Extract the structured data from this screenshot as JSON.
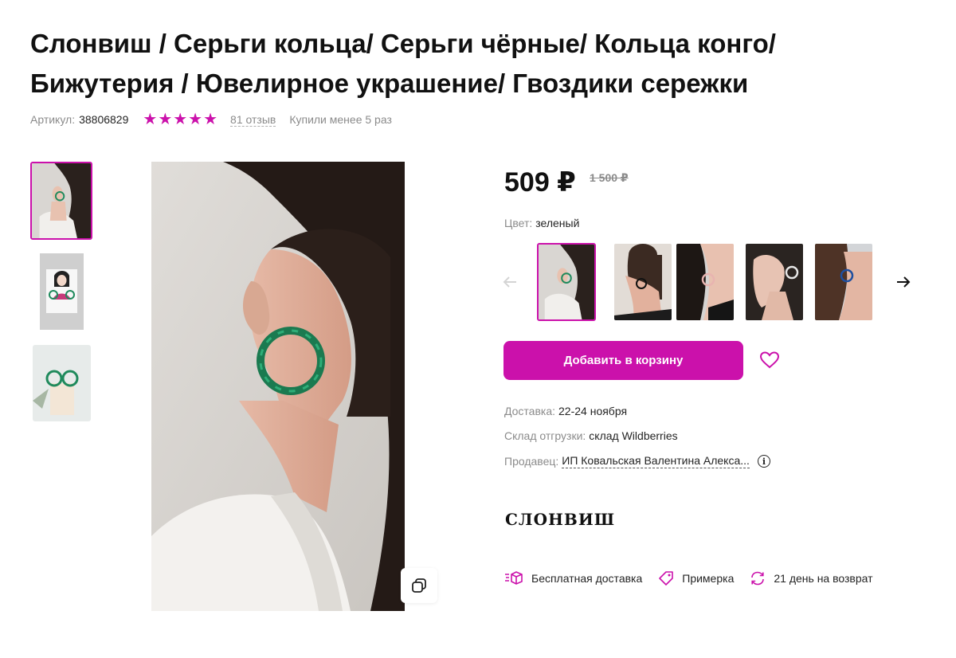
{
  "product": {
    "title": "Слонвиш / Серьги кольца/ Серьги чёрные/ Кольца конго/ Бижутерия / Ювелирное украшение/ Гвоздики сережки",
    "article_label": "Артикул:",
    "article_value": "38806829",
    "rating": 5,
    "stars_text": "★★★★★",
    "reviews": "81 отзыв",
    "bought": "Купили менее 5 раз"
  },
  "price": {
    "current": "509 ₽",
    "old": "1 500 ₽"
  },
  "color": {
    "label": "Цвет:",
    "value": "зеленый"
  },
  "gallery": {
    "thumbnails": [
      "photo-green-earring-model",
      "photo-card-illustration",
      "photo-green-earrings-display"
    ],
    "active_index": 0
  },
  "variants": [
    {
      "ring_color": "#1f8a5c",
      "active": true
    },
    {
      "ring_color": "#111111",
      "active": false
    },
    {
      "ring_color": "#e8b4b0",
      "active": false
    },
    {
      "ring_color": "#e6e6e6",
      "active": false
    },
    {
      "ring_color": "#1e4fa0",
      "active": false
    }
  ],
  "actions": {
    "add_to_cart": "Добавить в корзину"
  },
  "delivery": {
    "label": "Доставка:",
    "value": "22-24 ноября"
  },
  "warehouse": {
    "label": "Склад отгрузки:",
    "value": "склад Wildberries"
  },
  "seller": {
    "label": "Продавец:",
    "value": "ИП Ковальская Валентина Алекса...",
    "info_icon": "i"
  },
  "brand": {
    "logo_text": "СЛОНВИШ"
  },
  "features": [
    {
      "label": "Бесплатная доставка",
      "icon": "truck-box-icon"
    },
    {
      "label": "Примерка",
      "icon": "tag-icon"
    },
    {
      "label": "21 день на возврат",
      "icon": "refresh-icon"
    }
  ],
  "colors": {
    "accent": "#cb11ab",
    "muted_text": "#8b8b8b",
    "main_text": "#242424"
  }
}
